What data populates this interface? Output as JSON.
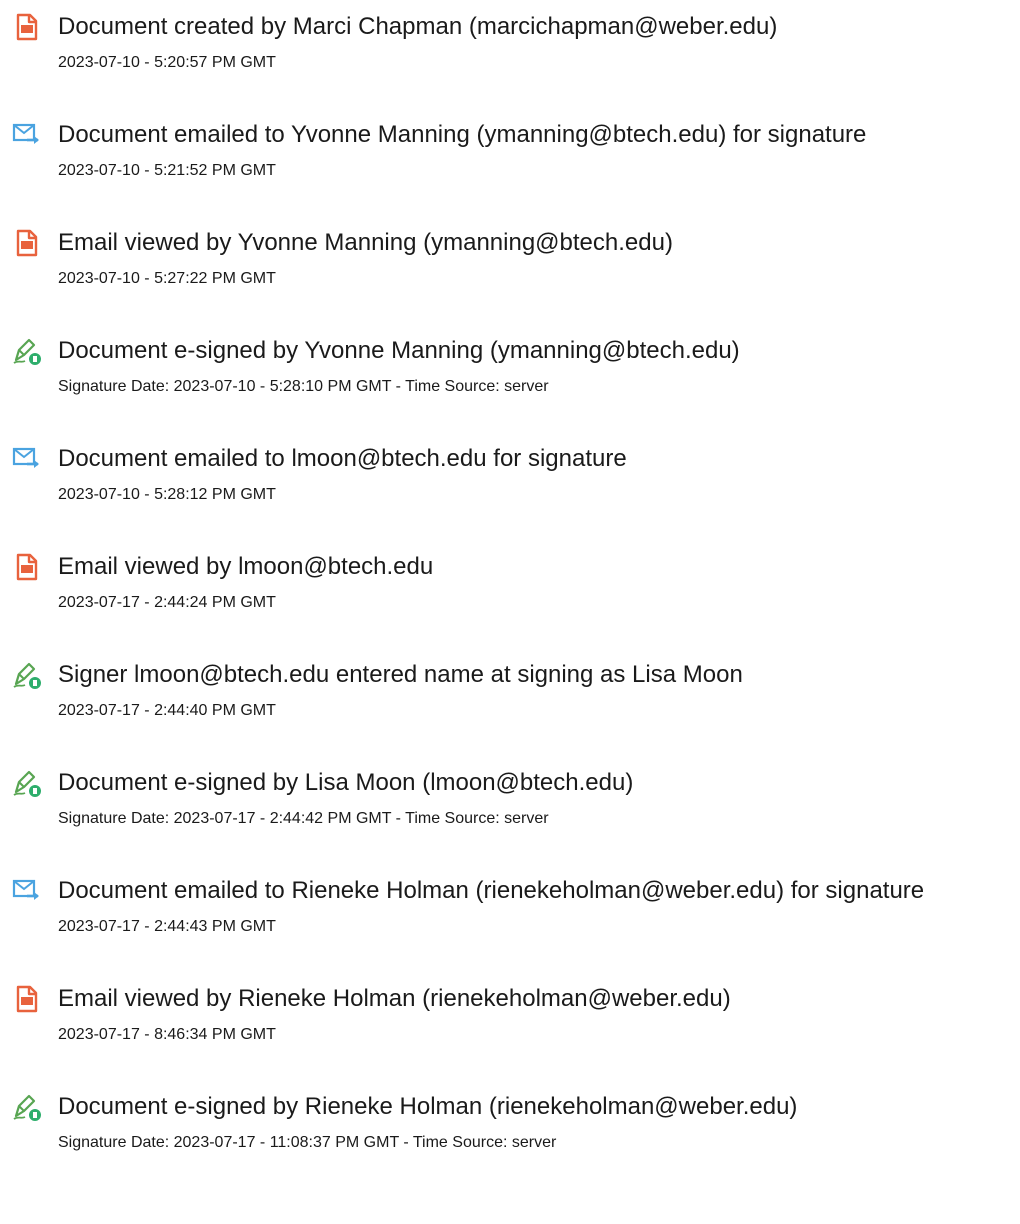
{
  "colors": {
    "created_icon": "#e8623d",
    "emailed_icon": "#4aa3e0",
    "signed_pen": "#58a552",
    "signed_badge": "#2eae6c"
  },
  "entries": [
    {
      "icon": "document-created-icon",
      "title": "Document created by Marci Chapman (marcichapman@weber.edu)",
      "subtitle": "2023-07-10 - 5:20:57 PM GMT"
    },
    {
      "icon": "email-send-icon",
      "title": "Document emailed to Yvonne Manning (ymanning@btech.edu) for signature",
      "subtitle": "2023-07-10 - 5:21:52 PM GMT"
    },
    {
      "icon": "document-viewed-icon",
      "title": "Email viewed by Yvonne Manning (ymanning@btech.edu)",
      "subtitle": "2023-07-10 - 5:27:22 PM GMT"
    },
    {
      "icon": "pen-signature-icon",
      "title": "Document e-signed by Yvonne Manning (ymanning@btech.edu)",
      "subtitle": "Signature Date: 2023-07-10 - 5:28:10 PM GMT - Time Source: server"
    },
    {
      "icon": "email-send-icon",
      "title": "Document emailed to lmoon@btech.edu for signature",
      "subtitle": "2023-07-10 - 5:28:12 PM GMT"
    },
    {
      "icon": "document-viewed-icon",
      "title": "Email viewed by lmoon@btech.edu",
      "subtitle": "2023-07-17 - 2:44:24 PM GMT"
    },
    {
      "icon": "pen-signature-icon",
      "title": "Signer lmoon@btech.edu entered name at signing as Lisa Moon",
      "subtitle": "2023-07-17 - 2:44:40 PM GMT"
    },
    {
      "icon": "pen-signature-icon",
      "title": "Document e-signed by Lisa Moon (lmoon@btech.edu)",
      "subtitle": "Signature Date: 2023-07-17 - 2:44:42 PM GMT - Time Source: server"
    },
    {
      "icon": "email-send-icon",
      "title": "Document emailed to Rieneke Holman (rienekeholman@weber.edu) for signature",
      "subtitle": "2023-07-17 - 2:44:43 PM GMT"
    },
    {
      "icon": "document-viewed-icon",
      "title": "Email viewed by Rieneke Holman (rienekeholman@weber.edu)",
      "subtitle": "2023-07-17 - 8:46:34 PM GMT"
    },
    {
      "icon": "pen-signature-icon",
      "title": "Document e-signed by Rieneke Holman (rienekeholman@weber.edu)",
      "subtitle": "Signature Date: 2023-07-17 - 11:08:37 PM GMT - Time Source: server"
    }
  ]
}
